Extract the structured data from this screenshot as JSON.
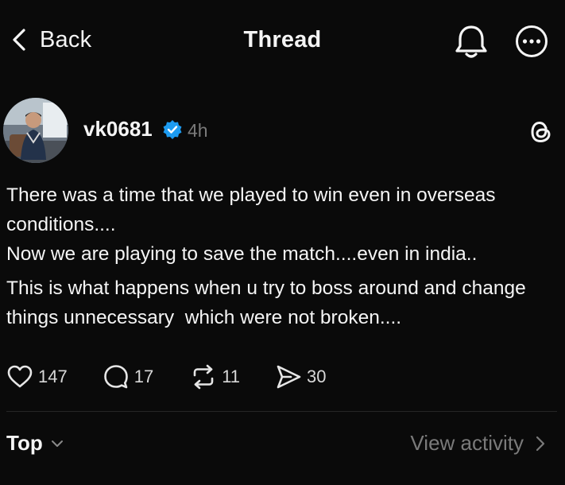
{
  "header": {
    "back_label": "Back",
    "title": "Thread",
    "icons": [
      "chevron-left-icon",
      "bell-icon",
      "more-icon"
    ]
  },
  "post": {
    "username": "vk0681",
    "verified": true,
    "time": "4h",
    "lines": [
      "There was a time that we played to win even in overseas conditions....",
      "Now we are playing to save the match....even in india..",
      "This is what happens when u try to boss around and change things unnecessary  which were not broken...."
    ],
    "stats": {
      "likes": "147",
      "replies": "17",
      "reposts": "11",
      "shares": "30"
    }
  },
  "replies": {
    "sort_label": "Top",
    "view_activity_label": "View activity"
  },
  "colors": {
    "background": "#0a0a0a",
    "text": "#f5f5f5",
    "muted": "#7a7a7a",
    "verified": "#1d9bf0",
    "divider": "#262626"
  }
}
